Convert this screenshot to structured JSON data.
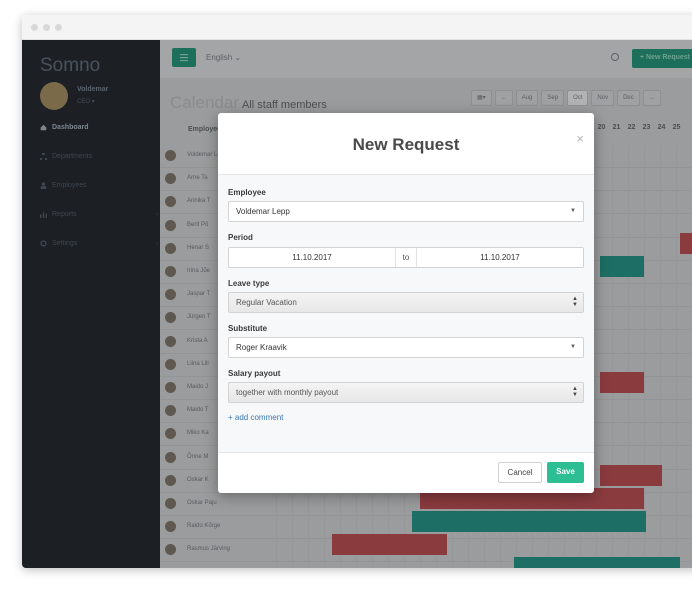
{
  "sidebar": {
    "brand": "Somno",
    "user": {
      "name": "Voldemar",
      "role": "CEO ▾"
    },
    "items": [
      {
        "label": "Dashboard",
        "icon": "home-icon"
      },
      {
        "label": "Departments",
        "icon": "sitemap-icon"
      },
      {
        "label": "Employees",
        "icon": "user-icon"
      },
      {
        "label": "Reports",
        "icon": "chart-icon"
      },
      {
        "label": "Settings",
        "icon": "gear-icon"
      }
    ]
  },
  "topbar": {
    "language": "English ⌄",
    "new_request_label": "+ New Request"
  },
  "calendar": {
    "title": "Calendar",
    "subtitle": "All staff members",
    "months": [
      "Aug",
      "Sep",
      "Oct",
      "Nov",
      "Dec"
    ],
    "column_header": "Employee",
    "day_numbers": [
      "20",
      "21",
      "22",
      "23",
      "24",
      "25"
    ],
    "employees": [
      "Voldemar Lepp",
      "Arne Ta",
      "Annika T",
      "Berit Põ",
      "Henar S",
      "Irina Jõe",
      "Jaspar T",
      "Jürgen T",
      "Krista A",
      "Liina Lill",
      "Maido J",
      "Maido T",
      "Miko Ka",
      "Õnne M",
      "Oskar K",
      "Oskar Paju",
      "Raido Kõrge",
      "Rasmus Järving"
    ]
  },
  "modal": {
    "title": "New Request",
    "close": "×",
    "employee_label": "Employee",
    "employee_value": "Voldemar Lepp",
    "period_label": "Period",
    "period_from": "11.10.2017",
    "period_to_word": "to",
    "period_to": "11.10.2017",
    "leave_type_label": "Leave type",
    "leave_type_value": "Regular Vacation",
    "substitute_label": "Substitute",
    "substitute_value": "Roger Kraavik",
    "salary_label": "Salary payout",
    "salary_value": "together with monthly payout",
    "add_comment": "+ add comment",
    "cancel_label": "Cancel",
    "save_label": "Save"
  },
  "colors": {
    "accent": "#2dbe93",
    "sidebar_bg": "#1c2025",
    "leave_teal": "#1d6e64",
    "leave_red": "#8a3b3e",
    "link": "#3a78b6"
  }
}
